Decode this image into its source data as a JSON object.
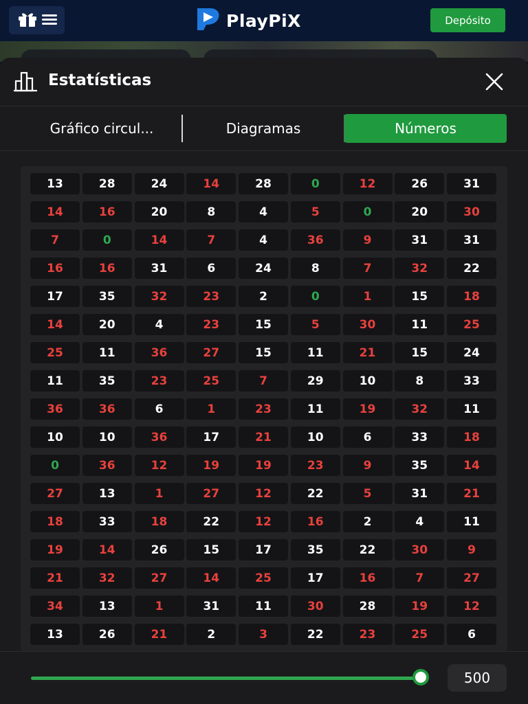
{
  "header": {
    "brand": "PlayPiX",
    "deposit_label": "Depósito",
    "icons": [
      "gift-icon",
      "menu-icon"
    ],
    "brand_color": "#1f9a3e"
  },
  "panel": {
    "title": "Estatísticas",
    "tabs": [
      {
        "label": "Gráfico circul...",
        "active": false
      },
      {
        "label": "Diagramas",
        "active": false
      },
      {
        "label": "Números",
        "active": true
      }
    ]
  },
  "numbers": {
    "colors": {
      "r": "#e8413d",
      "b": "#ffffff",
      "g": "#2fa84f"
    },
    "rows": [
      [
        [
          "13",
          "b"
        ],
        [
          "28",
          "b"
        ],
        [
          "24",
          "b"
        ],
        [
          "14",
          "r"
        ],
        [
          "28",
          "b"
        ],
        [
          "0",
          "g"
        ],
        [
          "12",
          "r"
        ],
        [
          "26",
          "b"
        ],
        [
          "31",
          "b"
        ]
      ],
      [
        [
          "14",
          "r"
        ],
        [
          "16",
          "r"
        ],
        [
          "20",
          "b"
        ],
        [
          "8",
          "b"
        ],
        [
          "4",
          "b"
        ],
        [
          "5",
          "r"
        ],
        [
          "0",
          "g"
        ],
        [
          "20",
          "b"
        ],
        [
          "30",
          "r"
        ]
      ],
      [
        [
          "7",
          "r"
        ],
        [
          "0",
          "g"
        ],
        [
          "14",
          "r"
        ],
        [
          "7",
          "r"
        ],
        [
          "4",
          "b"
        ],
        [
          "36",
          "r"
        ],
        [
          "9",
          "r"
        ],
        [
          "31",
          "b"
        ],
        [
          "31",
          "b"
        ]
      ],
      [
        [
          "16",
          "r"
        ],
        [
          "16",
          "r"
        ],
        [
          "31",
          "b"
        ],
        [
          "6",
          "b"
        ],
        [
          "24",
          "b"
        ],
        [
          "8",
          "b"
        ],
        [
          "7",
          "r"
        ],
        [
          "32",
          "r"
        ],
        [
          "22",
          "b"
        ]
      ],
      [
        [
          "17",
          "b"
        ],
        [
          "35",
          "b"
        ],
        [
          "32",
          "r"
        ],
        [
          "23",
          "r"
        ],
        [
          "2",
          "b"
        ],
        [
          "0",
          "g"
        ],
        [
          "1",
          "r"
        ],
        [
          "15",
          "b"
        ],
        [
          "18",
          "r"
        ]
      ],
      [
        [
          "14",
          "r"
        ],
        [
          "20",
          "b"
        ],
        [
          "4",
          "b"
        ],
        [
          "23",
          "r"
        ],
        [
          "15",
          "b"
        ],
        [
          "5",
          "r"
        ],
        [
          "30",
          "r"
        ],
        [
          "11",
          "b"
        ],
        [
          "25",
          "r"
        ]
      ],
      [
        [
          "25",
          "r"
        ],
        [
          "11",
          "b"
        ],
        [
          "36",
          "r"
        ],
        [
          "27",
          "r"
        ],
        [
          "15",
          "b"
        ],
        [
          "11",
          "b"
        ],
        [
          "21",
          "r"
        ],
        [
          "15",
          "b"
        ],
        [
          "24",
          "b"
        ]
      ],
      [
        [
          "11",
          "b"
        ],
        [
          "35",
          "b"
        ],
        [
          "23",
          "r"
        ],
        [
          "25",
          "r"
        ],
        [
          "7",
          "r"
        ],
        [
          "29",
          "b"
        ],
        [
          "10",
          "b"
        ],
        [
          "8",
          "b"
        ],
        [
          "33",
          "b"
        ]
      ],
      [
        [
          "36",
          "r"
        ],
        [
          "36",
          "r"
        ],
        [
          "6",
          "b"
        ],
        [
          "1",
          "r"
        ],
        [
          "23",
          "r"
        ],
        [
          "11",
          "b"
        ],
        [
          "19",
          "r"
        ],
        [
          "32",
          "r"
        ],
        [
          "11",
          "b"
        ]
      ],
      [
        [
          "10",
          "b"
        ],
        [
          "10",
          "b"
        ],
        [
          "36",
          "r"
        ],
        [
          "17",
          "b"
        ],
        [
          "21",
          "r"
        ],
        [
          "10",
          "b"
        ],
        [
          "6",
          "b"
        ],
        [
          "33",
          "b"
        ],
        [
          "18",
          "r"
        ]
      ],
      [
        [
          "0",
          "g"
        ],
        [
          "36",
          "r"
        ],
        [
          "12",
          "r"
        ],
        [
          "19",
          "r"
        ],
        [
          "19",
          "r"
        ],
        [
          "23",
          "r"
        ],
        [
          "9",
          "r"
        ],
        [
          "35",
          "b"
        ],
        [
          "14",
          "r"
        ]
      ],
      [
        [
          "27",
          "r"
        ],
        [
          "13",
          "b"
        ],
        [
          "1",
          "r"
        ],
        [
          "27",
          "r"
        ],
        [
          "12",
          "r"
        ],
        [
          "22",
          "b"
        ],
        [
          "5",
          "r"
        ],
        [
          "31",
          "b"
        ],
        [
          "21",
          "r"
        ]
      ],
      [
        [
          "18",
          "r"
        ],
        [
          "33",
          "b"
        ],
        [
          "18",
          "r"
        ],
        [
          "22",
          "b"
        ],
        [
          "12",
          "r"
        ],
        [
          "16",
          "r"
        ],
        [
          "2",
          "b"
        ],
        [
          "4",
          "b"
        ],
        [
          "11",
          "b"
        ]
      ],
      [
        [
          "19",
          "r"
        ],
        [
          "14",
          "r"
        ],
        [
          "26",
          "b"
        ],
        [
          "15",
          "b"
        ],
        [
          "17",
          "b"
        ],
        [
          "35",
          "b"
        ],
        [
          "22",
          "b"
        ],
        [
          "30",
          "r"
        ],
        [
          "9",
          "r"
        ]
      ],
      [
        [
          "21",
          "r"
        ],
        [
          "32",
          "r"
        ],
        [
          "27",
          "r"
        ],
        [
          "14",
          "r"
        ],
        [
          "25",
          "r"
        ],
        [
          "17",
          "b"
        ],
        [
          "16",
          "r"
        ],
        [
          "7",
          "r"
        ],
        [
          "27",
          "r"
        ]
      ],
      [
        [
          "34",
          "r"
        ],
        [
          "13",
          "b"
        ],
        [
          "1",
          "r"
        ],
        [
          "31",
          "b"
        ],
        [
          "11",
          "b"
        ],
        [
          "30",
          "r"
        ],
        [
          "28",
          "b"
        ],
        [
          "19",
          "r"
        ],
        [
          "12",
          "r"
        ]
      ],
      [
        [
          "13",
          "b"
        ],
        [
          "26",
          "b"
        ],
        [
          "21",
          "r"
        ],
        [
          "2",
          "b"
        ],
        [
          "3",
          "r"
        ],
        [
          "22",
          "b"
        ],
        [
          "23",
          "r"
        ],
        [
          "25",
          "r"
        ],
        [
          "6",
          "b"
        ]
      ]
    ]
  },
  "slider": {
    "value": 500,
    "value_label": "500",
    "fill_fraction": 1.0
  }
}
